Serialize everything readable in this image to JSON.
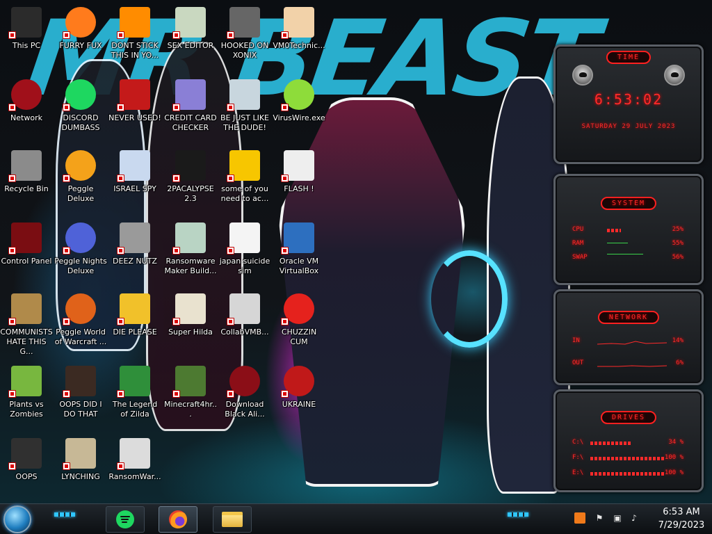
{
  "wallpaper": {
    "title_text": "MR BEAST"
  },
  "desktop_icons": [
    {
      "label": "This PC",
      "icon": "this-pc-icon"
    },
    {
      "label": "FURRY FUX",
      "icon": "firefox-icon"
    },
    {
      "label": "DONT STICK THIS IN YO...",
      "icon": "vlc-cone-icon"
    },
    {
      "label": "SEX EDITOR",
      "icon": "hxd-editor-icon"
    },
    {
      "label": "HOOKED ON XONIX",
      "icon": "xonix-game-icon"
    },
    {
      "label": "VM0Technic...",
      "icon": "doctor-person-icon"
    },
    {
      "label": "Network",
      "icon": "network-alien-icon"
    },
    {
      "label": "DISCORD DUMBASS",
      "icon": "spotify-icon"
    },
    {
      "label": "NEVER USED!",
      "icon": "devcpp-icon"
    },
    {
      "label": "CREDIT CARD CHECKER",
      "icon": "credit-card-icon"
    },
    {
      "label": "BE JUST LIKE THE DUDE!",
      "icon": "santa-dude-icon"
    },
    {
      "label": "VirusWire.exe",
      "icon": "lime-icon"
    },
    {
      "label": "Recycle Bin",
      "icon": "recycle-bin-icon"
    },
    {
      "label": "Peggle Deluxe",
      "icon": "peggle-icon"
    },
    {
      "label": "ISRAEL SPY",
      "icon": "spy-folder-icon"
    },
    {
      "label": "2PACALYPSE 2.3",
      "icon": "console-icon"
    },
    {
      "label": "some of you need to ac...",
      "icon": "beaver-icon"
    },
    {
      "label": "FLASH !",
      "icon": "flash-document-icon"
    },
    {
      "label": "Control Panel",
      "icon": "control-panel-icon"
    },
    {
      "label": "Peggle Nights Deluxe",
      "icon": "peggle-nights-icon"
    },
    {
      "label": "DEEZ NUTZ",
      "icon": "stacked-windows-icon"
    },
    {
      "label": "Ransomware Maker Build...",
      "icon": "ransomware-window-icon"
    },
    {
      "label": "japan suicide sim",
      "icon": "document-icon"
    },
    {
      "label": "Oracle VM VirtualBox",
      "icon": "virtualbox-icon"
    },
    {
      "label": "COMMUNISTS HATE THIS G...",
      "icon": "money-bag-icon"
    },
    {
      "label": "Peggle World of Warcraft ...",
      "icon": "peggle-wow-icon"
    },
    {
      "label": "DIE PLEASE",
      "icon": "director-icon"
    },
    {
      "label": "Super Hilda",
      "icon": "pixel-dog-icon"
    },
    {
      "label": "CollabVMB...",
      "icon": "monitor-icon"
    },
    {
      "label": "CHUZZIN CUM",
      "icon": "chuzzle-icon"
    },
    {
      "label": "Plants vs Zombies",
      "icon": "plants-vs-zombies-icon"
    },
    {
      "label": "OOPS DID I DO THAT",
      "icon": "portrait-woman-icon"
    },
    {
      "label": "The Legend of Zilda",
      "icon": "pixel-hero-icon"
    },
    {
      "label": "Minecraft4hr...",
      "icon": "minecraft-icon"
    },
    {
      "label": "Download Black Ali...",
      "icon": "alien-orb-icon"
    },
    {
      "label": "UKRAINE",
      "icon": "radiation-icon"
    },
    {
      "label": "OOPS",
      "icon": "broken-monitor-icon"
    },
    {
      "label": "LYNCHING",
      "icon": "noose-icon"
    },
    {
      "label": "RansomWar...",
      "icon": "skull-icon"
    }
  ],
  "widgets": {
    "time": {
      "title": "TIME",
      "time": "6:53:02",
      "date": "SATURDAY 29 JULY 2023"
    },
    "system": {
      "title": "SYSTEM",
      "rows": [
        {
          "key": "CPU",
          "value": "25%",
          "fill": 0.25
        },
        {
          "key": "RAM",
          "value": "55%",
          "fill": 0.55
        },
        {
          "key": "SWAP",
          "value": "56%",
          "fill": 0.56
        }
      ]
    },
    "network": {
      "title": "NETWORK",
      "rows": [
        {
          "key": "IN",
          "value": "14%"
        },
        {
          "key": "OUT",
          "value": "6%"
        }
      ]
    },
    "drives": {
      "title": "DRIVES",
      "rows": [
        {
          "key": "C:\\",
          "value": "34 %",
          "fill": 0.34
        },
        {
          "key": "F:\\",
          "value": "100 %",
          "fill": 1.0
        },
        {
          "key": "E:\\",
          "value": "100 %",
          "fill": 1.0
        }
      ]
    }
  },
  "taskbar": {
    "start_label": "Start",
    "pinned": [
      {
        "name": "spotify",
        "icon": "spotify-icon"
      },
      {
        "name": "firefox",
        "icon": "firefox-icon",
        "active": true
      },
      {
        "name": "file-explorer",
        "icon": "folder-icon"
      }
    ],
    "tray": [
      "orange-app-icon",
      "flag-icon",
      "network-icon",
      "volume-icon"
    ],
    "clock": {
      "time": "6:53 AM",
      "date": "7/29/2023"
    }
  },
  "colors": {
    "accent_red": "#ff2a2a",
    "accent_cyan": "#2fc6ff"
  }
}
